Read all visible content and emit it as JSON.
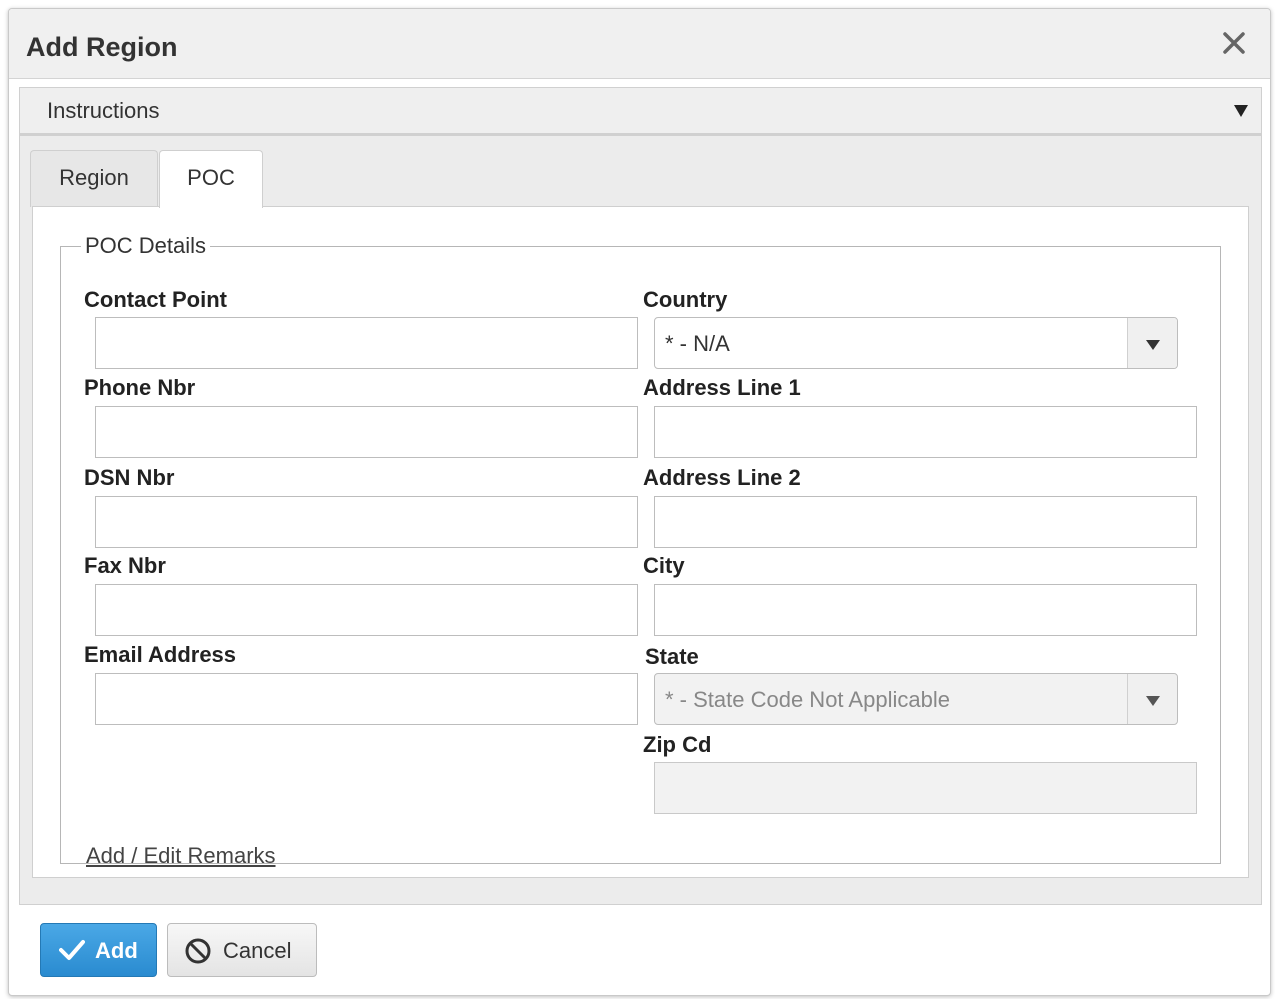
{
  "dialog": {
    "title": "Add Region",
    "instructions_label": "Instructions"
  },
  "tabs": [
    {
      "label": "Region",
      "active": false
    },
    {
      "label": "POC",
      "active": true
    }
  ],
  "poc": {
    "legend": "POC Details",
    "contact_point": {
      "label": "Contact Point",
      "value": ""
    },
    "phone_nbr": {
      "label": "Phone Nbr",
      "value": ""
    },
    "dsn_nbr": {
      "label": "DSN Nbr",
      "value": ""
    },
    "fax_nbr": {
      "label": "Fax Nbr",
      "value": ""
    },
    "email_address": {
      "label": "Email Address",
      "value": ""
    },
    "country": {
      "label": "Country",
      "value": "* - N/A"
    },
    "address_line_1": {
      "label": "Address Line 1",
      "value": ""
    },
    "address_line_2": {
      "label": "Address Line 2",
      "value": ""
    },
    "city": {
      "label": "City",
      "value": ""
    },
    "state": {
      "label": "State",
      "value": "* - State Code Not Applicable",
      "disabled": true
    },
    "zip_cd": {
      "label": "Zip Cd",
      "value": "",
      "disabled": true
    },
    "remarks_link": "Add / Edit Remarks"
  },
  "footer": {
    "add_label": "Add",
    "cancel_label": "Cancel"
  },
  "colors": {
    "primary_button": "#2a8bd0",
    "header_bg": "#f0f0f0"
  }
}
